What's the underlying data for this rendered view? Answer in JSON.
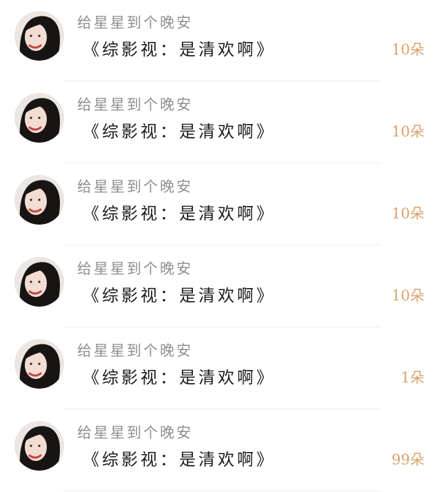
{
  "gift_list": {
    "items": [
      {
        "action": "给星星到个晚安",
        "title": "《综影视：是清欢啊》",
        "count": "10朵",
        "avatar_icon": "user-avatar-photo"
      },
      {
        "action": "给星星到个晚安",
        "title": "《综影视：是清欢啊》",
        "count": "10朵",
        "avatar_icon": "user-avatar-photo"
      },
      {
        "action": "给星星到个晚安",
        "title": "《综影视：是清欢啊》",
        "count": "10朵",
        "avatar_icon": "user-avatar-photo"
      },
      {
        "action": "给星星到个晚安",
        "title": "《综影视：是清欢啊》",
        "count": "10朵",
        "avatar_icon": "user-avatar-photo"
      },
      {
        "action": "给星星到个晚安",
        "title": "《综影视：是清欢啊》",
        "count": "1朵",
        "avatar_icon": "user-avatar-photo"
      },
      {
        "action": "给星星到个晚安",
        "title": "《综影视：是清欢啊》",
        "count": "99朵",
        "avatar_icon": "user-avatar-photo"
      }
    ]
  },
  "colors": {
    "count_accent": "#d8a36d",
    "action_gray": "#8f8f8f",
    "title_text": "#1c1c1c"
  }
}
